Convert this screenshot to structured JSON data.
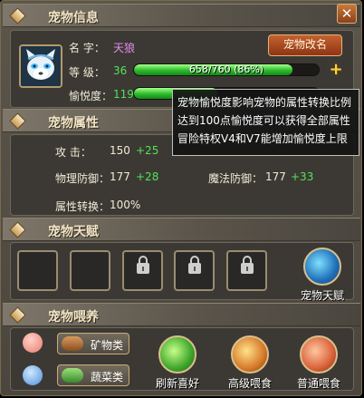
{
  "sections": {
    "info": "宠物信息",
    "attributes": "宠物属性",
    "talent": "宠物天赋",
    "feeding": "宠物喂养"
  },
  "close_icon": "✕",
  "pet": {
    "name_label": "名  字：",
    "name": "天狼",
    "level_label": "等  级：",
    "level": "36",
    "exp_text": "658/760 (86%)",
    "exp_fraction": 0.86,
    "happiness_label": "愉悦度：",
    "happiness": "119",
    "happiness_fraction": 0.45,
    "rename_button": "宠物改名"
  },
  "tooltip": {
    "lines": [
      "宠物愉悦度影响宠物的属性转换比例",
      "达到100点愉悦度可以获得全部属性",
      "冒险特权V4和V7能增加愉悦度上限"
    ]
  },
  "attributes": {
    "attack_label": "攻    击：",
    "attack_value": "150",
    "attack_bonus": "+25",
    "phys_def_label": "物理防御：",
    "phys_def_value": "177",
    "phys_def_bonus": "+28",
    "magic_def_label": "魔法防御：",
    "magic_def_value": "177",
    "magic_def_bonus": "+33",
    "convert_label": "属性转换：",
    "convert_value": "100%"
  },
  "talent": {
    "button": "宠物天赋",
    "slots": [
      "empty",
      "empty",
      "locked",
      "locked",
      "locked"
    ]
  },
  "feeding": {
    "food1": "矿物类",
    "food2": "蔬菜类",
    "refresh": "刷新喜好",
    "advanced": "高级喂食",
    "normal": "普通喂食"
  },
  "colors": {
    "accent_green": "#51e35a",
    "name_pink": "#e28ef0",
    "title_cream": "#f3e6c6"
  }
}
